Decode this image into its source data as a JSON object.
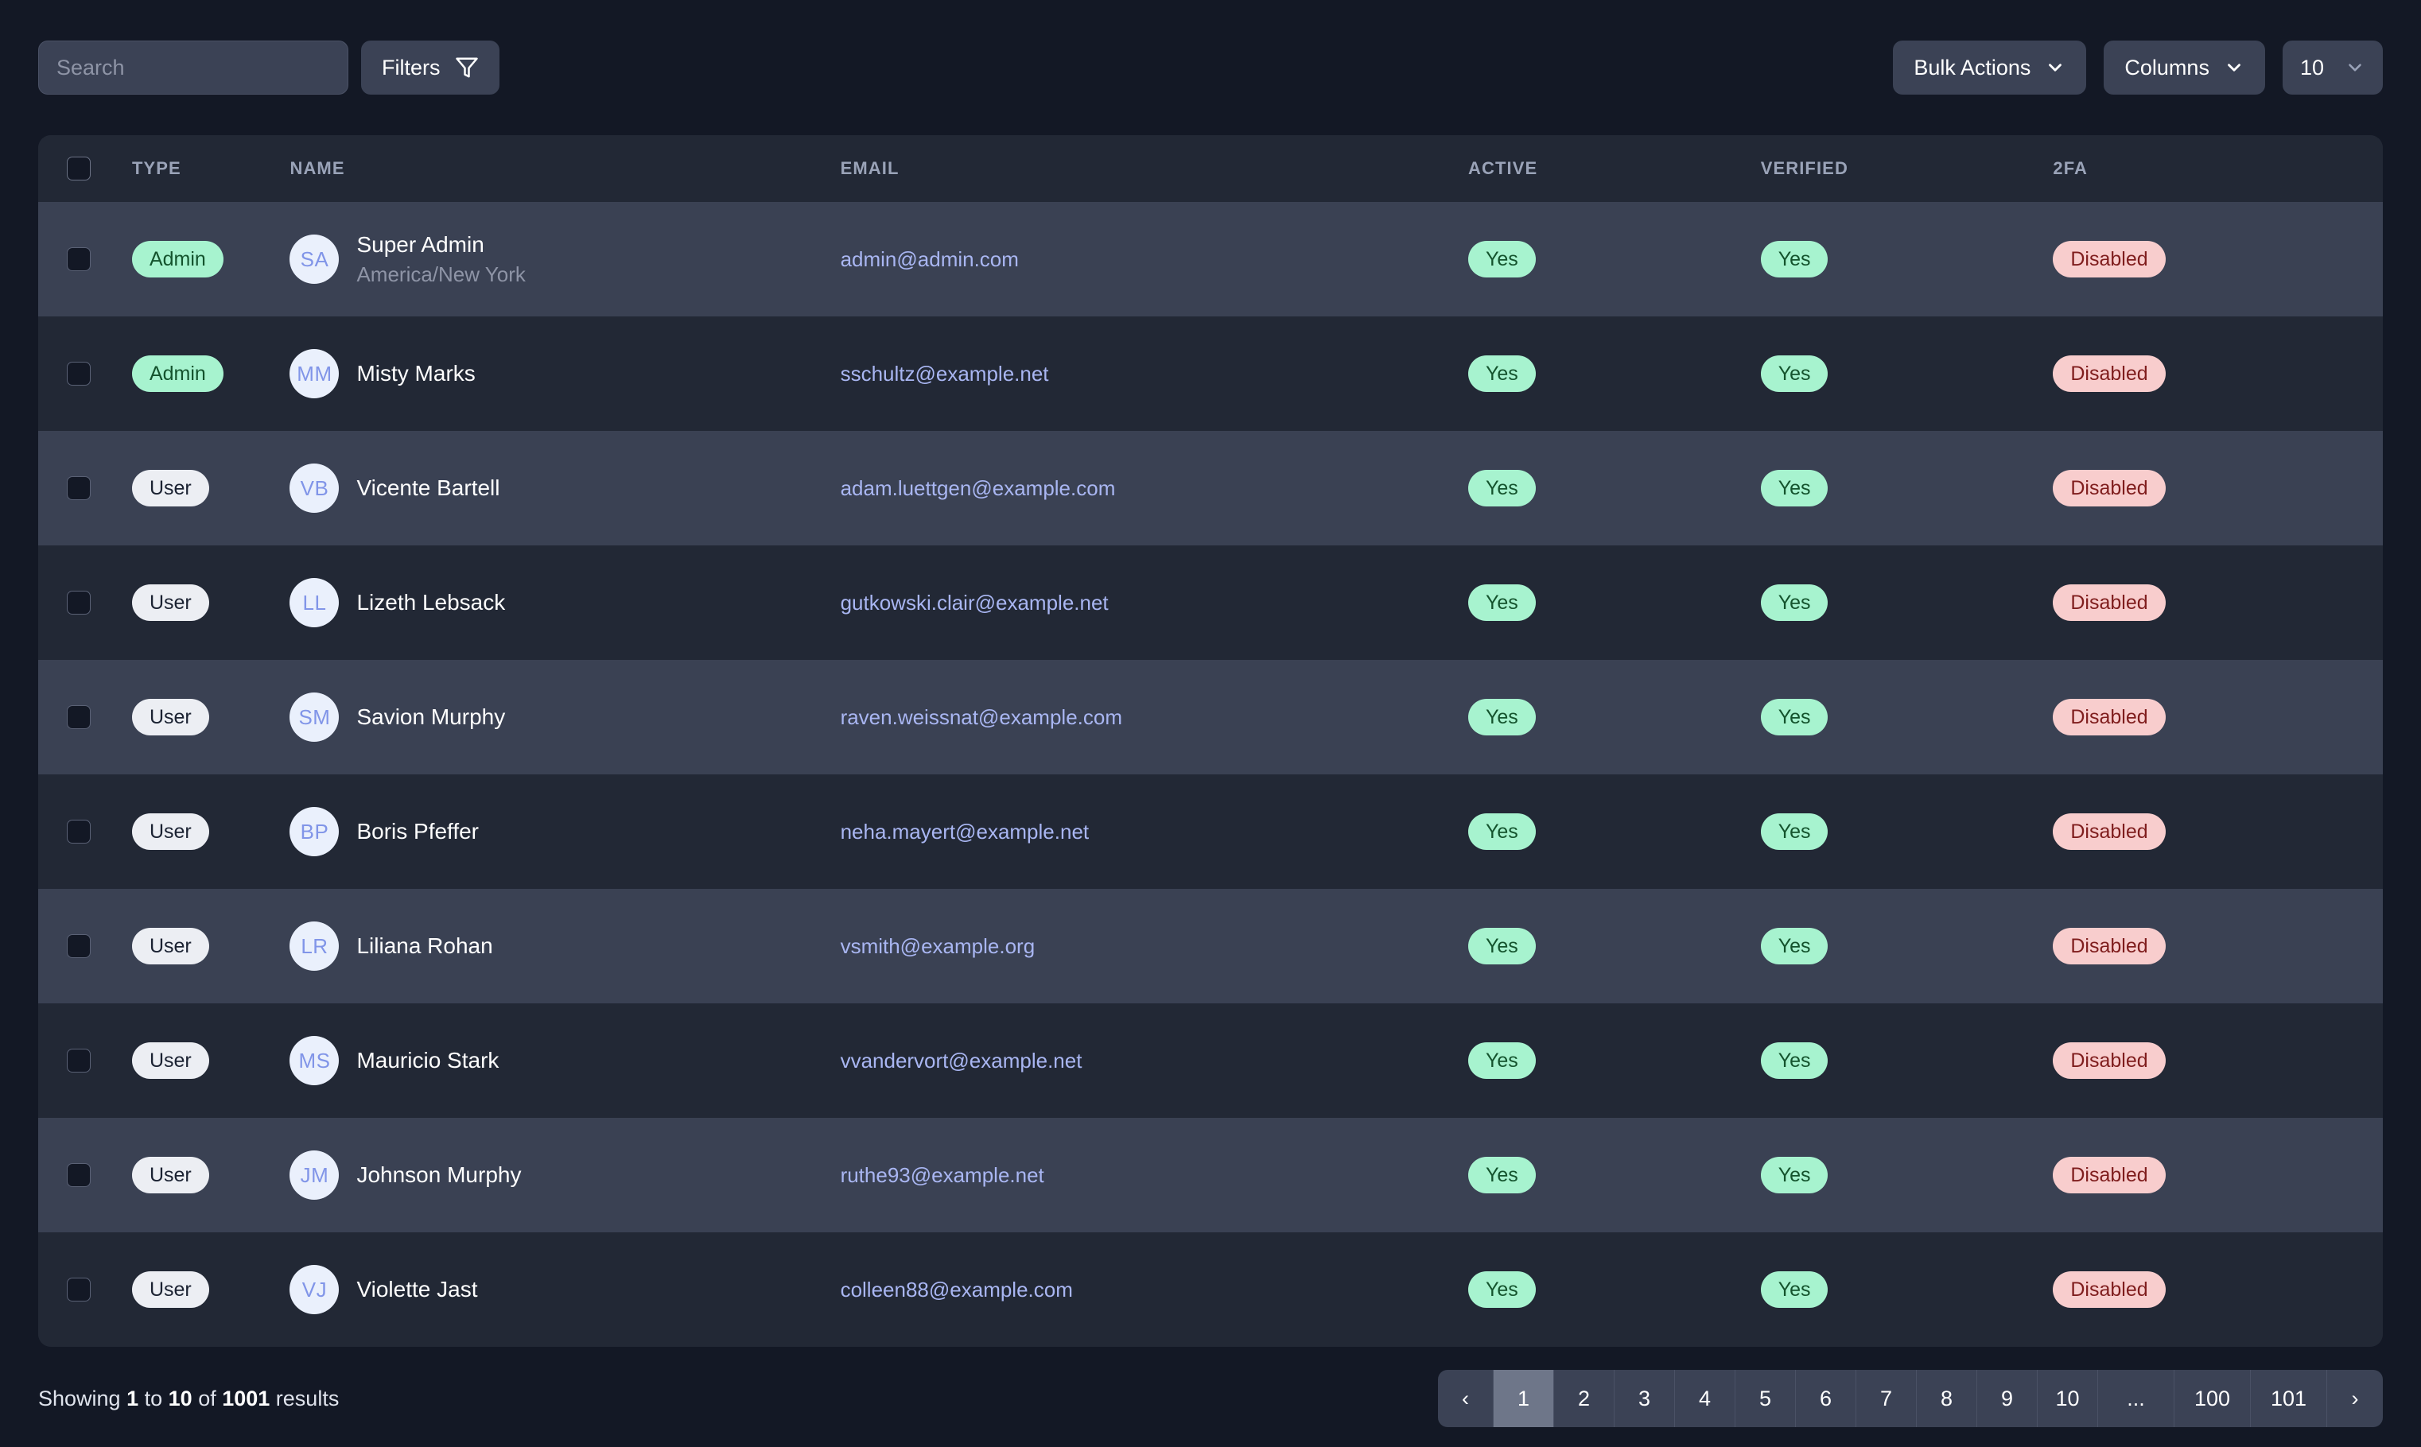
{
  "toolbar": {
    "search_placeholder": "Search",
    "search_value": "",
    "filters_label": "Filters",
    "bulk_actions_label": "Bulk Actions",
    "columns_label": "Columns",
    "page_size_value": "10"
  },
  "table": {
    "headers": {
      "type": "TYPE",
      "name": "NAME",
      "email": "EMAIL",
      "active": "ACTIVE",
      "verified": "VERIFIED",
      "twofa": "2FA"
    },
    "rows": [
      {
        "type": "Admin",
        "type_variant": "admin",
        "initials": "SA",
        "name": "Super Admin",
        "subtitle": "America/New York",
        "email": "admin@admin.com",
        "active": "Yes",
        "verified": "Yes",
        "twofa": "Disabled"
      },
      {
        "type": "Admin",
        "type_variant": "admin",
        "initials": "MM",
        "name": "Misty Marks",
        "subtitle": "",
        "email": "sschultz@example.net",
        "active": "Yes",
        "verified": "Yes",
        "twofa": "Disabled"
      },
      {
        "type": "User",
        "type_variant": "user",
        "initials": "VB",
        "name": "Vicente Bartell",
        "subtitle": "",
        "email": "adam.luettgen@example.com",
        "active": "Yes",
        "verified": "Yes",
        "twofa": "Disabled"
      },
      {
        "type": "User",
        "type_variant": "user",
        "initials": "LL",
        "name": "Lizeth Lebsack",
        "subtitle": "",
        "email": "gutkowski.clair@example.net",
        "active": "Yes",
        "verified": "Yes",
        "twofa": "Disabled"
      },
      {
        "type": "User",
        "type_variant": "user",
        "initials": "SM",
        "name": "Savion Murphy",
        "subtitle": "",
        "email": "raven.weissnat@example.com",
        "active": "Yes",
        "verified": "Yes",
        "twofa": "Disabled"
      },
      {
        "type": "User",
        "type_variant": "user",
        "initials": "BP",
        "name": "Boris Pfeffer",
        "subtitle": "",
        "email": "neha.mayert@example.net",
        "active": "Yes",
        "verified": "Yes",
        "twofa": "Disabled"
      },
      {
        "type": "User",
        "type_variant": "user",
        "initials": "LR",
        "name": "Liliana Rohan",
        "subtitle": "",
        "email": "vsmith@example.org",
        "active": "Yes",
        "verified": "Yes",
        "twofa": "Disabled"
      },
      {
        "type": "User",
        "type_variant": "user",
        "initials": "MS",
        "name": "Mauricio Stark",
        "subtitle": "",
        "email": "vvandervort@example.net",
        "active": "Yes",
        "verified": "Yes",
        "twofa": "Disabled"
      },
      {
        "type": "User",
        "type_variant": "user",
        "initials": "JM",
        "name": "Johnson Murphy",
        "subtitle": "",
        "email": "ruthe93@example.net",
        "active": "Yes",
        "verified": "Yes",
        "twofa": "Disabled"
      },
      {
        "type": "User",
        "type_variant": "user",
        "initials": "VJ",
        "name": "Violette Jast",
        "subtitle": "",
        "email": "colleen88@example.com",
        "active": "Yes",
        "verified": "Yes",
        "twofa": "Disabled"
      }
    ]
  },
  "footer": {
    "showing_prefix": "Showing ",
    "showing_from": "1",
    "showing_mid": " to ",
    "showing_to": "10",
    "showing_of": " of ",
    "showing_total": "1001",
    "showing_suffix": " results",
    "pagination": {
      "prev_label": "‹",
      "next_label": "›",
      "current_page": "1",
      "pages": [
        "1",
        "2",
        "3",
        "4",
        "5",
        "6",
        "7",
        "8",
        "9",
        "10",
        "...",
        "100",
        "101"
      ]
    }
  },
  "colors": {
    "page_background": "#131825",
    "card_background": "#222835",
    "row_odd": "#3a4153",
    "row_even": "#222835",
    "control_background": "#3b4255",
    "badge_green_bg": "#a7f3cf",
    "badge_green_text": "#14532d",
    "badge_gray_bg": "#eceef3",
    "badge_gray_text": "#1b2232",
    "badge_pink_bg": "#f8cdcd",
    "badge_pink_text": "#7f1d1d",
    "link": "#a9b6f2",
    "avatar_bg": "#eaf0fc",
    "avatar_text": "#8195e8"
  }
}
